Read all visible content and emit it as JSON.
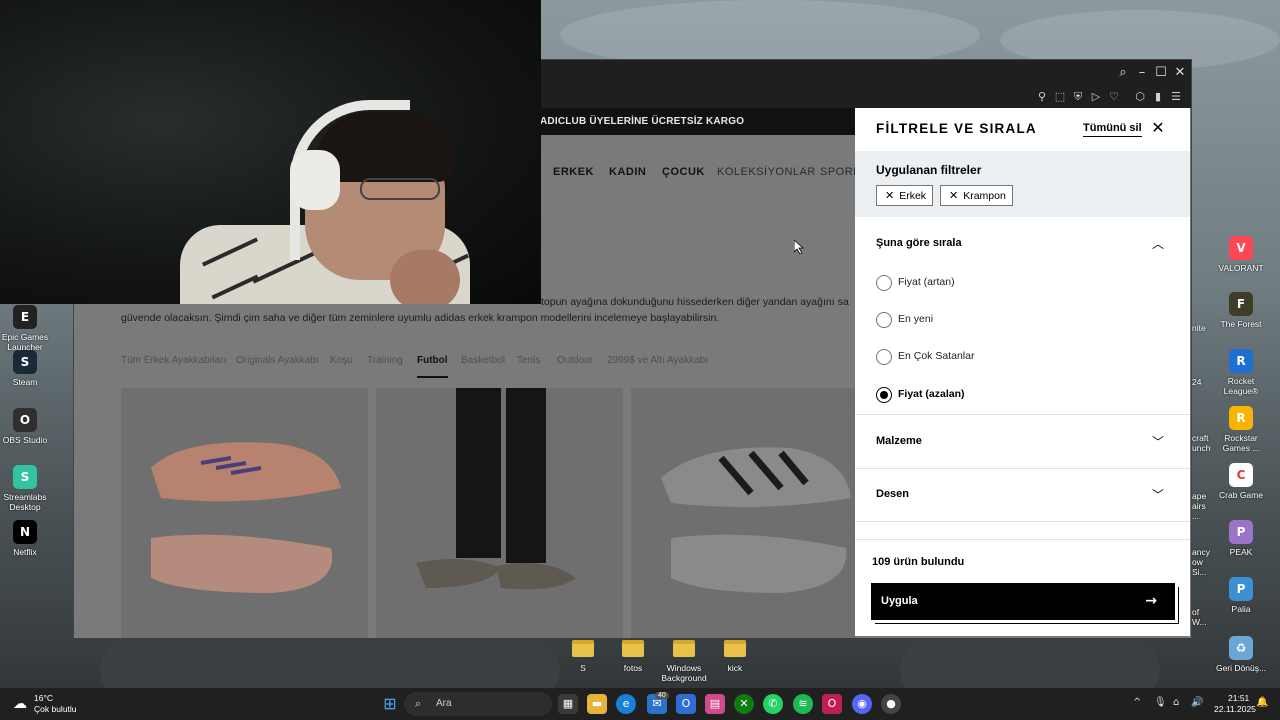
{
  "browser": {
    "window_controls": [
      "search",
      "minimize",
      "maximize",
      "close"
    ]
  },
  "page": {
    "promo": "ADICLUB ÜYELERİNE ÜCRETSİZ KARGO",
    "nav": [
      "ERKEK",
      "KADIN",
      "ÇOCUK",
      "KOLEKSİYONLAR",
      "SPORLAR"
    ],
    "description_line1": "topun ayağına dokunduğunu hissederken diğer yandan ayağını sa",
    "description_line2": "güvende olacaksın. Şimdi çim saha ve diğer tüm zeminlere uyumlu adidas erkek krampon modellerini incelemeye başlayabilirsin.",
    "categories": [
      "Tüm Erkek Ayakkabıları",
      "Originals Ayakkabı",
      "Koşu",
      "Training",
      "Futbol",
      "Basketbol",
      "Tenis",
      "Outdoor",
      "2999$ ve Altı Ayakkabı"
    ],
    "active_category": "Futbol"
  },
  "panel": {
    "title": "FİLTRELE VE SIRALA",
    "clear_all": "Tümünü sil",
    "applied_title": "Uygulanan filtreler",
    "applied_filters": [
      "Erkek",
      "Krampon"
    ],
    "sort_title": "Şuna göre sırala",
    "sort_options": [
      "Fiyat (artan)",
      "En yeni",
      "En Çok Satanlar",
      "Fiyat (azalan)"
    ],
    "sort_selected": "Fiyat (azalan)",
    "sections": [
      "Malzeme",
      "Desen"
    ],
    "result_count": "109 ürün bulundu",
    "apply_label": "Uygula"
  },
  "desktop_left": [
    {
      "label": "Epic Games Launcher",
      "color": "#222222",
      "glyph": "E"
    },
    {
      "label": "Steam",
      "color": "#1b2838",
      "glyph": "S"
    },
    {
      "label": "OBS Studio",
      "color": "#302e31",
      "glyph": "O"
    },
    {
      "label": "Streamlabs Desktop",
      "color": "#31c3a2",
      "glyph": "S"
    },
    {
      "label": "Netflix",
      "color": "#000000",
      "glyph": "N"
    }
  ],
  "desktop_right": [
    {
      "label": "VALORANT",
      "color": "#ff4655",
      "glyph": "V"
    },
    {
      "label": "The Forest",
      "color": "#3d3d2a",
      "glyph": "F"
    },
    {
      "label": "Rocket League®",
      "color": "#1d6fd1",
      "glyph": "R"
    },
    {
      "label": "Rockstar Games ...",
      "color": "#f7b500",
      "glyph": "R"
    },
    {
      "label": "Crab Game",
      "color": "#ffffff",
      "glyph": "C"
    },
    {
      "label": "PEAK",
      "color": "#9b73c9",
      "glyph": "P"
    },
    {
      "label": "Palia",
      "color": "#3b8fd4",
      "glyph": "P"
    },
    {
      "label": "Geri Dönüş...",
      "color": "#6aa6d6",
      "glyph": "♻"
    }
  ],
  "desktop_partial": [
    "nite",
    "24",
    "craft uncher",
    "ape airs ...",
    "ancy's ow Si...",
    "of W..."
  ],
  "folders": [
    "S",
    "fotos",
    "Windows Background",
    "kick"
  ],
  "taskbar": {
    "weather_temp": "16°C",
    "weather_desc": "Çok bulutlu",
    "search_placeholder": "Ara",
    "mail_badge": "40",
    "time": "21:51",
    "date": "22.11.2025"
  }
}
